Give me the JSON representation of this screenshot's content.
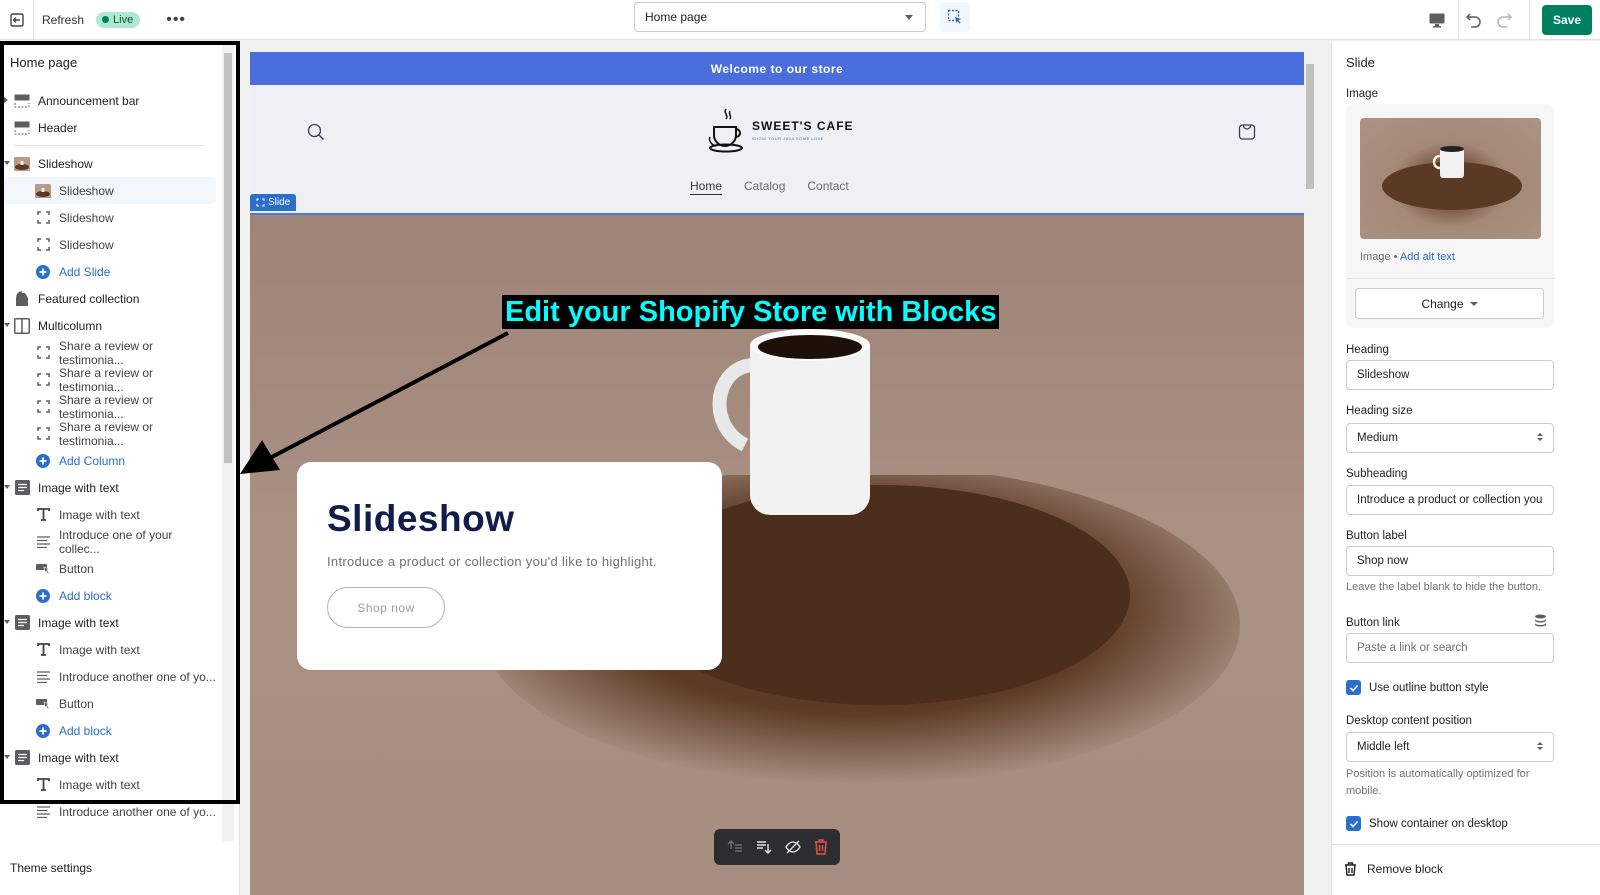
{
  "topbar": {
    "refresh_label": "Refresh",
    "live_badge": "Live",
    "more_label": "•••",
    "page_select_value": "Home page",
    "save_label": "Save"
  },
  "left_panel": {
    "title": "Home page",
    "theme_settings_label": "Theme settings",
    "items": [
      {
        "type": "section",
        "label": "Announcement bar",
        "icon": "layout-header-icon",
        "arrow": "right"
      },
      {
        "type": "section",
        "label": "Header",
        "icon": "layout-header-icon"
      },
      {
        "type": "section",
        "label": "Slideshow",
        "icon": "image-thumb-icon",
        "arrow": "down"
      },
      {
        "type": "block",
        "label": "Slideshow",
        "icon": "image-thumb-icon",
        "selected": true
      },
      {
        "type": "block",
        "label": "Slideshow",
        "icon": "dashed-square-icon"
      },
      {
        "type": "block",
        "label": "Slideshow",
        "icon": "dashed-square-icon"
      },
      {
        "type": "add",
        "label": "Add Slide",
        "icon": "plus-circle-icon"
      },
      {
        "type": "section",
        "label": "Featured collection",
        "icon": "tag-icon"
      },
      {
        "type": "section",
        "label": "Multicolumn",
        "icon": "columns-icon",
        "arrow": "down"
      },
      {
        "type": "block",
        "label": "Share a review or testimonia...",
        "icon": "dashed-square-icon"
      },
      {
        "type": "block",
        "label": "Share a review or testimonia...",
        "icon": "dashed-square-icon"
      },
      {
        "type": "block",
        "label": "Share a review or testimonia...",
        "icon": "dashed-square-icon"
      },
      {
        "type": "block",
        "label": "Share a review or testimonia...",
        "icon": "dashed-square-icon"
      },
      {
        "type": "add",
        "label": "Add Column",
        "icon": "plus-circle-icon"
      },
      {
        "type": "section",
        "label": "Image with text",
        "icon": "document-icon",
        "arrow": "down"
      },
      {
        "type": "block",
        "label": "Image with text",
        "icon": "text-t-icon"
      },
      {
        "type": "block",
        "label": "Introduce one of your collec...",
        "icon": "text-lines-icon"
      },
      {
        "type": "block",
        "label": "Button",
        "icon": "button-cursor-icon"
      },
      {
        "type": "add",
        "label": "Add block",
        "icon": "plus-circle-icon"
      },
      {
        "type": "section",
        "label": "Image with text",
        "icon": "document-icon",
        "arrow": "down"
      },
      {
        "type": "block",
        "label": "Image with text",
        "icon": "text-t-icon"
      },
      {
        "type": "block",
        "label": "Introduce another one of yo...",
        "icon": "text-lines-icon"
      },
      {
        "type": "block",
        "label": "Button",
        "icon": "button-cursor-icon"
      },
      {
        "type": "add",
        "label": "Add block",
        "icon": "plus-circle-icon"
      },
      {
        "type": "section",
        "label": "Image with text",
        "icon": "document-icon",
        "arrow": "down"
      },
      {
        "type": "block",
        "label": "Image with text",
        "icon": "text-t-icon"
      },
      {
        "type": "block",
        "label": "Introduce another one of yo...",
        "icon": "text-lines-icon"
      }
    ]
  },
  "preview": {
    "announcement": "Welcome to our store",
    "logo_name": "SWEET'S CAFE",
    "logo_tagline": "SHOW YOUR JAVA SOME LOVE",
    "nav": [
      "Home",
      "Catalog",
      "Contact"
    ],
    "slide_tag": "Slide",
    "annotation_caption": "Edit your Shopify Store with Blocks",
    "card_heading": "Slideshow",
    "card_subheading": "Introduce a product or collection you'd like to highlight.",
    "card_button": "Shop now"
  },
  "right_panel": {
    "title": "Slide",
    "image_label": "Image",
    "image_caption_prefix": "Image • ",
    "add_alt_text": "Add alt text",
    "change_label": "Change",
    "heading_label": "Heading",
    "heading_value": "Slideshow",
    "heading_size_label": "Heading size",
    "heading_size_value": "Medium",
    "subheading_label": "Subheading",
    "subheading_value": "Introduce a product or collection you",
    "button_label_label": "Button label",
    "button_label_value": "Shop now",
    "button_label_help": "Leave the label blank to hide the button.",
    "button_link_label": "Button link",
    "button_link_placeholder": "Paste a link or search",
    "outline_checkbox_label": "Use outline button style",
    "outline_checked": true,
    "position_label": "Desktop content position",
    "position_value": "Middle left",
    "position_help": "Position is automatically optimized for mobile.",
    "container_checkbox_label": "Show container on desktop",
    "container_checked": true,
    "remove_label": "Remove block"
  },
  "colors": {
    "accent": "#2c6ecb",
    "save": "#008060",
    "announcement": "#4a6fdc",
    "caption_text": "#00ffff",
    "heading": "#121c4a"
  }
}
